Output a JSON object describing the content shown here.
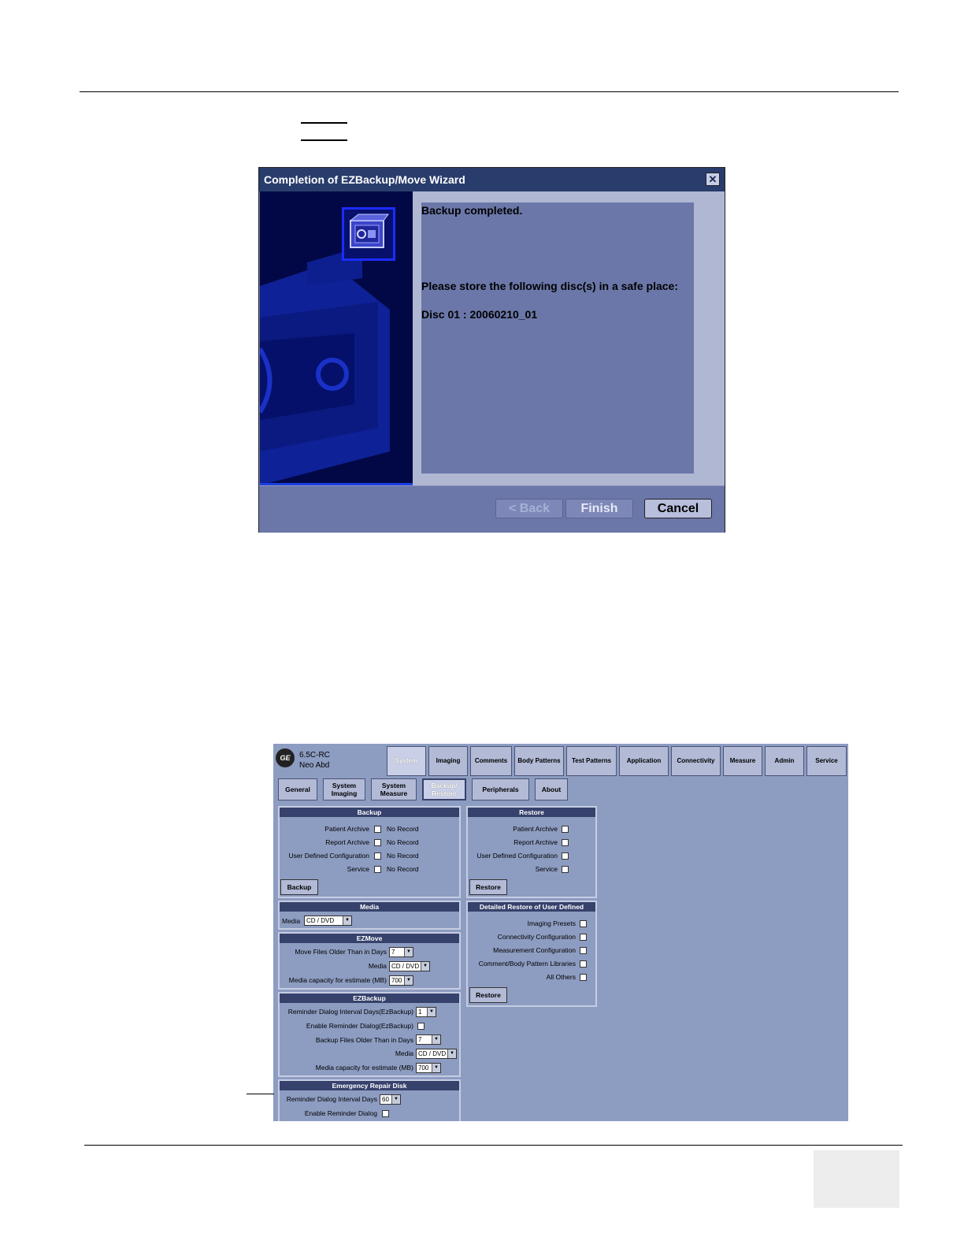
{
  "wizard": {
    "title": "Completion of EZBackup/Move Wizard",
    "close_symbol": "✕",
    "message_line1": "Backup completed.",
    "message_line2": "Please store the following disc(s) in a safe place:",
    "disc_line": "Disc 01 : 20060210_01",
    "back_label": "< Back",
    "finish_label": "Finish",
    "cancel_label": "Cancel",
    "icon_name": "backup-disc-icon"
  },
  "config": {
    "logo": "GE",
    "version": "6.5C-RC",
    "probe": "Neo Abd",
    "top_tabs": [
      "System",
      "Imaging",
      "Comments",
      "Body Patterns",
      "Test Patterns",
      "Application",
      "Connectivity",
      "Measure",
      "Admin",
      "Service"
    ],
    "active_top_tab": "System",
    "sub_tabs": [
      "General",
      "System Imaging",
      "System Measure",
      "Backup/ Restore",
      "Peripherals",
      "About"
    ],
    "active_sub_tab": "Backup/ Restore",
    "backup": {
      "title": "Backup",
      "rows": [
        {
          "label": "Patient Archive",
          "status": "No Record"
        },
        {
          "label": "Report Archive",
          "status": "No Record"
        },
        {
          "label": "User Defined Configuration",
          "status": "No Record"
        },
        {
          "label": "Service",
          "status": "No Record"
        }
      ],
      "button": "Backup"
    },
    "restore": {
      "title": "Restore",
      "rows": [
        "Patient Archive",
        "Report Archive",
        "User Defined Configuration",
        "Service"
      ],
      "button": "Restore"
    },
    "media": {
      "title": "Media",
      "label": "Media",
      "value": "CD / DVD"
    },
    "detailed_restore": {
      "title": "Detailed Restore of User Defined",
      "rows": [
        "Imaging Presets",
        "Connectivity Configuration",
        "Measurement Configuration",
        "Comment/Body Pattern Libraries",
        "All Others"
      ],
      "button": "Restore"
    },
    "ezmove": {
      "title": "EZMove",
      "move_label": "Move Files Older Than in Days",
      "move_value": "7",
      "media_label": "Media",
      "media_value": "CD / DVD",
      "capacity_label": "Media capacity for estimate (MB)",
      "capacity_value": "700"
    },
    "ezbackup": {
      "title": "EZBackup",
      "reminder_label": "Reminder Dialog Interval Days(EzBackup)",
      "reminder_value": "1",
      "enable_label": "Enable Reminder Dialog(EzBackup)",
      "older_label": "Backup Files Older Than in Days",
      "older_value": "7",
      "media_label": "Media",
      "media_value": "CD / DVD",
      "capacity_label": "Media capacity for estimate (MB)",
      "capacity_value": "700"
    },
    "emergency": {
      "title": "Emergency Repair Disk",
      "interval_label": "Reminder Dialog Interval Days",
      "interval_value": "60",
      "enable_label": "Enable Reminder Dialog"
    }
  }
}
